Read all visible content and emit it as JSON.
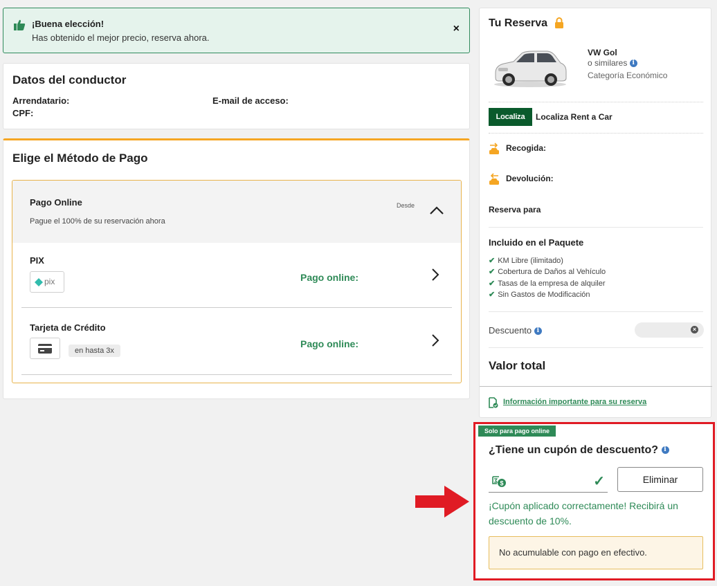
{
  "alert": {
    "title": "¡Buena elección!",
    "message": "Has obtenido el mejor precio, reserva ahora.",
    "close_label": "×"
  },
  "driver": {
    "title": "Datos del conductor",
    "renter_label": "Arrendatario:",
    "email_label": "E-mail de acceso:",
    "cpf_label": "CPF:"
  },
  "payment": {
    "title": "Elige el Método de Pago",
    "online": {
      "title": "Pago Online",
      "subtitle": "Pague el 100% de su reservación ahora",
      "desde": "Desde"
    },
    "options": [
      {
        "name": "PIX",
        "logo_text": "pix",
        "status": "Pago online:"
      },
      {
        "name": "Tarjeta de Crédito",
        "chip": "en hasta 3x",
        "status": "Pago online:"
      }
    ]
  },
  "reservation": {
    "title": "Tu Reserva",
    "car_name": "VW Gol",
    "similar": "o similares",
    "category": "Categoría Económico",
    "company_logo": "Localiza",
    "company_name": "Localiza Rent a Car",
    "pickup_label": "Recogida:",
    "return_label": "Devolución:",
    "reserve_for": "Reserva para",
    "included_title": "Incluido en el Paquete",
    "included": [
      "KM Libre (ilimitado)",
      "Cobertura de Daños al Vehículo",
      "Tasas de la empresa de alquiler",
      "Sin Gastos de Modificación"
    ],
    "discount_label": "Descuento",
    "total_label": "Valor total",
    "info_link": "Información importante para su reserva"
  },
  "coupon": {
    "tag": "Solo para pago online",
    "title": "¿Tiene un cupón de descuento?",
    "remove_button": "Eliminar",
    "success_message": "¡Cupón aplicado correctamente! Recibirá un descuento de 10%.",
    "note": "No acumulable con pago en efectivo."
  },
  "colors": {
    "brand_green": "#2e8a57",
    "highlight_red": "#e01b24",
    "accent_orange": "#f5a623",
    "info_blue": "#3f7ac1"
  }
}
